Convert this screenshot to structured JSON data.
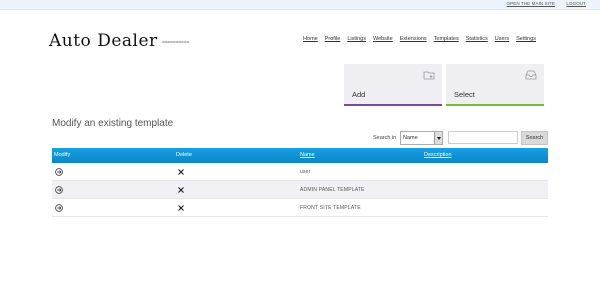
{
  "top_links": [
    "OPEN THE MAIN SITE",
    "LOGOUT"
  ],
  "brand": {
    "title": "Auto Dealer",
    "subtitle": "=========="
  },
  "nav": [
    "Home",
    "Profile",
    "Listings",
    "Website",
    "Extensions",
    "Templates",
    "Statistics",
    "Users",
    "Settings"
  ],
  "tiles": {
    "add_label": "Add",
    "select_label": "Select"
  },
  "page_title": "Modify an existing template",
  "search": {
    "label": "Search in",
    "selected_field": "Name",
    "query": "",
    "button_label": "Search"
  },
  "table": {
    "headers": {
      "modify": "Modify",
      "delete": "Delete",
      "name": "Name",
      "description": "Description"
    },
    "rows": [
      {
        "name": "user",
        "description": ""
      },
      {
        "name": "ADMIN PANEL TEMPLATE",
        "description": ""
      },
      {
        "name": "FRONT SITE TEMPLATE",
        "description": ""
      }
    ]
  },
  "colors": {
    "header_blue": "#0a86c8",
    "add_accent": "#7a4aa0",
    "select_accent": "#7ab83a"
  }
}
